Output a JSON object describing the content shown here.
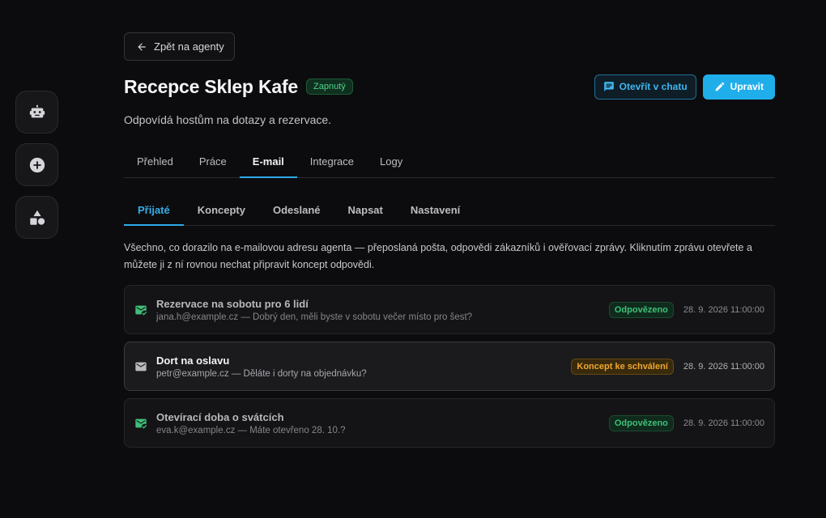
{
  "nav": {
    "back_label": "Zpět na agenty"
  },
  "rail": {
    "items": [
      {
        "icon": "robot-icon"
      },
      {
        "icon": "add-circle-icon"
      },
      {
        "icon": "shapes-icon"
      }
    ]
  },
  "agent": {
    "name": "Recepce Sklep Kafe",
    "status": "Zapnutý",
    "description": "Odpovídá hostům na dotazy a rezervace."
  },
  "actions": {
    "open_chat": "Otevřít v chatu",
    "edit": "Upravit"
  },
  "tabs": [
    {
      "label": "Přehled"
    },
    {
      "label": "Práce"
    },
    {
      "label": "E-mail"
    },
    {
      "label": "Integrace"
    },
    {
      "label": "Logy"
    }
  ],
  "subtabs": [
    {
      "label": "Přijaté"
    },
    {
      "label": "Koncepty"
    },
    {
      "label": "Odeslané"
    },
    {
      "label": "Napsat"
    },
    {
      "label": "Nastavení"
    }
  ],
  "inbox": {
    "description": "Všechno, co dorazilo na e-mailovou adresu agenta — přeposlaná pošta, odpovědi zákazníků i ověřovací zprávy. Kliknutím zprávu otevřete a můžete ji z ní rovnou nechat připravit koncept odpovědi.",
    "messages": [
      {
        "subject": "Rezervace na sobotu pro 6 lidí",
        "meta": "jana.h@example.cz — Dobrý den, měli byste v sobotu večer místo pro šest?",
        "status": "Odpovězeno",
        "date": "28. 9. 2026 11:00:00"
      },
      {
        "subject": "Dort na oslavu",
        "meta": "petr@example.cz — Děláte i dorty na objednávku?",
        "status": "Koncept ke schválení",
        "date": "28. 9. 2026 11:00:00"
      },
      {
        "subject": "Otevírací doba o svátcích",
        "meta": "eva.k@example.cz — Máte otevřeno 28. 10.?",
        "status": "Odpovězeno",
        "date": "28. 9. 2026 11:00:00"
      }
    ]
  },
  "colors": {
    "accent": "#1faeea",
    "replied": "#3fbf7a",
    "draft": "#f0a72f",
    "background": "#0c0c0e"
  }
}
